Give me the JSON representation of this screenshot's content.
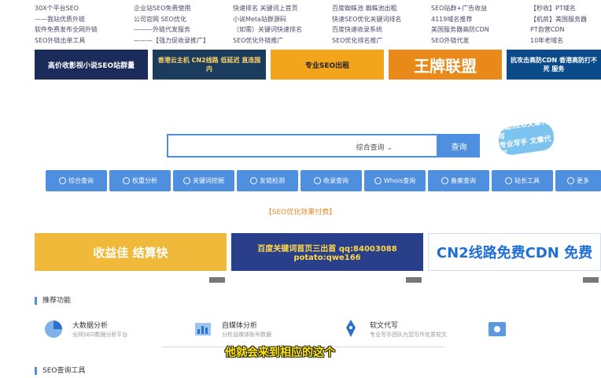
{
  "top_links": {
    "col1": [
      "30X个平台SEO",
      "——我站优质外链",
      "软件免费发布全网外链",
      "SEO外链出单工具"
    ],
    "col2": [
      "企业站SEO免费使用",
      "公司官网 SEO优化",
      "———外链代发服务",
      "———【强力促收录推广】"
    ],
    "col3": [
      "快速排名 关键词上首页",
      "小说Meta站群源码",
      "（如需）关键词快速排名",
      "SEO优化外链推广"
    ],
    "col4": [
      "百度蜘蛛池 蜘蛛池出租",
      "快速SEO优化关键词排名",
      "百度快速收录系统",
      "SEO优化排名推广"
    ],
    "col5": [
      "SEO站群+广告收益",
      "4119域名推荐",
      "美国服务器高防CDN",
      "SEO外链代发"
    ],
    "col6": [
      "【秒收】PT域名",
      "【机房】美国服务器",
      "PT自营CDN",
      "10年老域名"
    ]
  },
  "banners_top": [
    {
      "text": "高价收影视小说SEO站群量",
      "bg": "#1b2b5a",
      "color": "#ffffff"
    },
    {
      "text": "香港云主机 CN2线路 低延迟 直连国内",
      "bg": "#1c3c5e",
      "color": "#ffd66b"
    },
    {
      "text": "专业SEO出租",
      "bg": "#f2a51a",
      "color": "#222222"
    },
    {
      "text": "王牌联盟",
      "bg": "#e8891a",
      "color": "#ffffff"
    },
    {
      "text": "抗攻击高防CDN 香港高防打不死 服务",
      "bg": "#0b4b8b",
      "color": "#ffffff"
    }
  ],
  "search": {
    "placeholder": "",
    "select_label": "综合查询",
    "button_label": "查询"
  },
  "badge": {
    "line1": "爱站SEO文章代写",
    "line2": "专业写手 文章代写"
  },
  "nav": [
    {
      "label": "综合查询",
      "icon": "search-icon"
    },
    {
      "label": "权重分析",
      "icon": "chart-icon"
    },
    {
      "label": "关键词挖掘",
      "icon": "key-icon"
    },
    {
      "label": "友链检测",
      "icon": "link-icon"
    },
    {
      "label": "收录查询",
      "icon": "book-icon"
    },
    {
      "label": "Whois查询",
      "icon": "globe-icon"
    },
    {
      "label": "备案查询",
      "icon": "shield-icon"
    },
    {
      "label": "站长工具",
      "icon": "tool-icon"
    },
    {
      "label": "更多",
      "icon": "more-icon"
    }
  ],
  "seo_ad_link": "【SEO优化效果付费】",
  "banners_mid": [
    {
      "text": "收益佳 结算快",
      "bg": "#f0b93a",
      "color": "#ffffff"
    },
    {
      "text": "百度关键词首页三出首 qq:84003088 potato:qwe166",
      "bg": "#2a3f8a",
      "color": "#ffd84a"
    },
    {
      "text": "CN2线路免费CDN 免费",
      "bg": "#ffffff",
      "color": "#1f6fd6"
    }
  ],
  "sections": {
    "recommend": "推荐功能",
    "seo_tools": "SEO查询工具"
  },
  "features": [
    {
      "title": "大数据分析",
      "desc": "全网SEO数据分析平台",
      "icon": "pie-chart-icon"
    },
    {
      "title": "自媒体分析",
      "desc": "分析自媒体账号数据",
      "icon": "bar-chart-icon"
    },
    {
      "title": "软文代写",
      "desc": "专业写手团队为您写作优质软文",
      "icon": "pen-icon"
    },
    {
      "title": "",
      "desc": "",
      "icon": "window-icon"
    }
  ],
  "subtitle": "他就会来到相应的这个",
  "colors": {
    "primary": "#4f8fe0",
    "accent": "#e88a2b",
    "subtitle": "#ffe600"
  }
}
